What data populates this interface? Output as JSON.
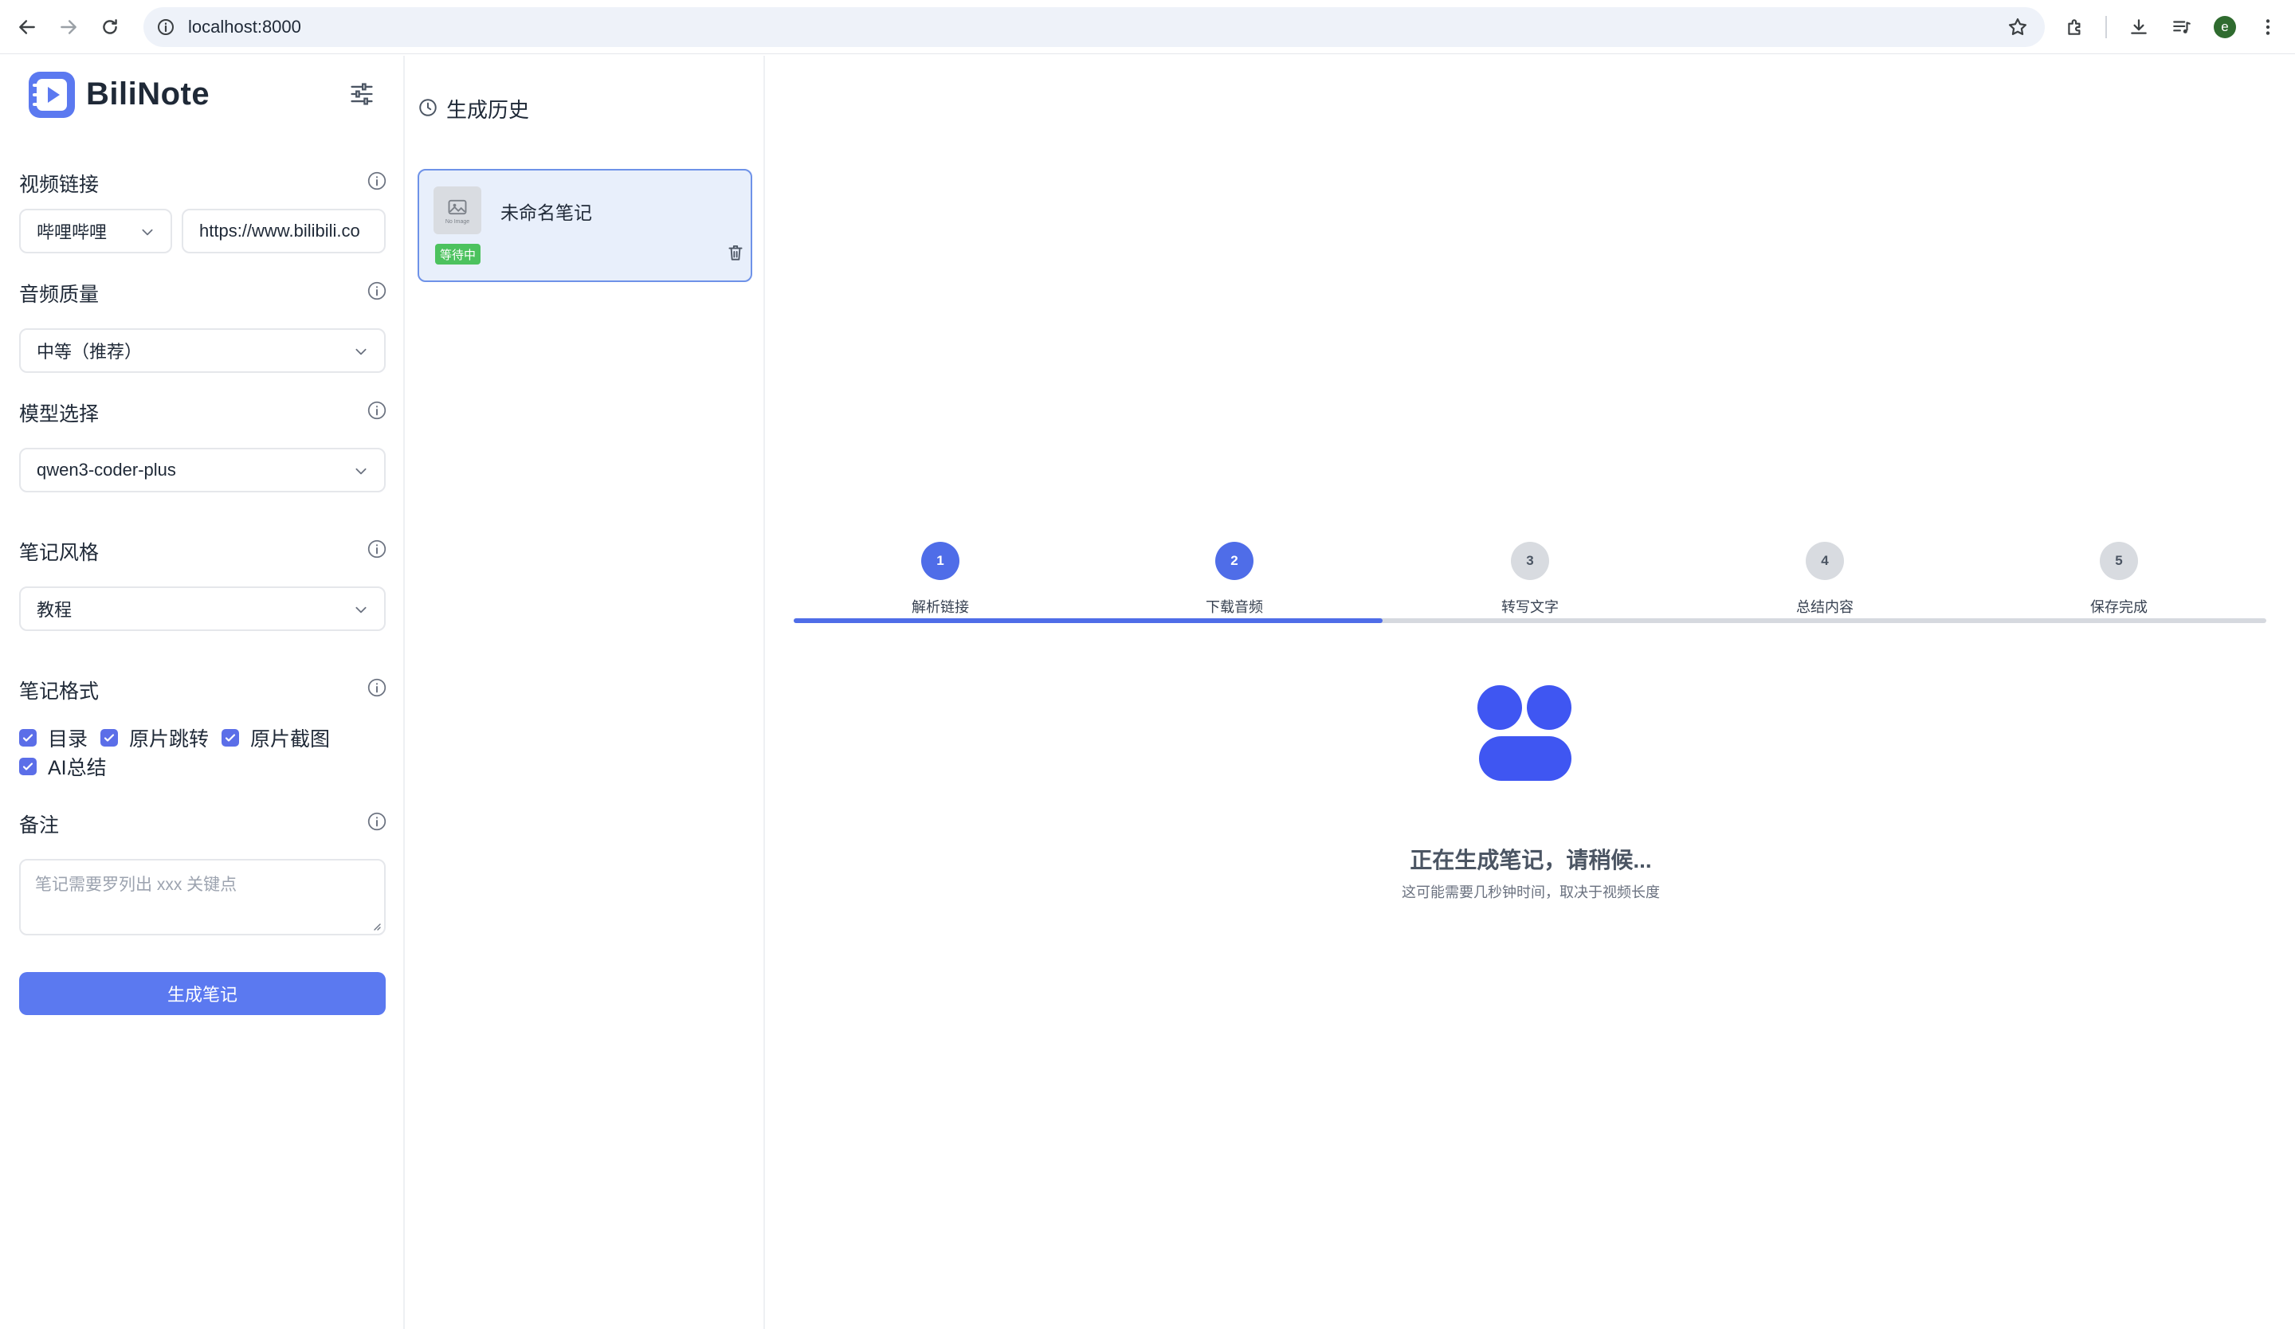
{
  "browser": {
    "url": "localhost:8000",
    "profile_initial": "e"
  },
  "app": {
    "brand": "BiliNote",
    "brand_color": "#5b79f0"
  },
  "form": {
    "video_link": {
      "label": "视频链接",
      "platform": "哔哩哔哩",
      "url_value": "https://www.bilibili.co"
    },
    "audio_quality": {
      "label": "音频质量",
      "value": "中等（推荐）"
    },
    "model": {
      "label": "模型选择",
      "value": "qwen3-coder-plus"
    },
    "note_style": {
      "label": "笔记风格",
      "value": "教程"
    },
    "note_format": {
      "label": "笔记格式",
      "options": [
        {
          "label": "目录",
          "checked": true
        },
        {
          "label": "原片跳转",
          "checked": true
        },
        {
          "label": "原片截图",
          "checked": true
        },
        {
          "label": "AI总结",
          "checked": true
        }
      ]
    },
    "remark": {
      "label": "备注",
      "placeholder": "笔记需要罗列出 xxx 关键点"
    },
    "submit_label": "生成笔记"
  },
  "history": {
    "title": "生成历史",
    "items": [
      {
        "title": "未命名笔记",
        "status": "等待中",
        "thumb_caption": "No Image"
      }
    ]
  },
  "progress": {
    "steps": [
      {
        "number": "1",
        "label": "解析链接",
        "active": true
      },
      {
        "number": "2",
        "label": "下载音频",
        "active": true
      },
      {
        "number": "3",
        "label": "转写文字",
        "active": false
      },
      {
        "number": "4",
        "label": "总结内容",
        "active": false
      },
      {
        "number": "5",
        "label": "保存完成",
        "active": false
      }
    ],
    "fraction_complete": 0.4,
    "loading_title": "正在生成笔记，请稍候...",
    "loading_subtitle": "这可能需要几秒钟时间，取决于视频长度"
  }
}
